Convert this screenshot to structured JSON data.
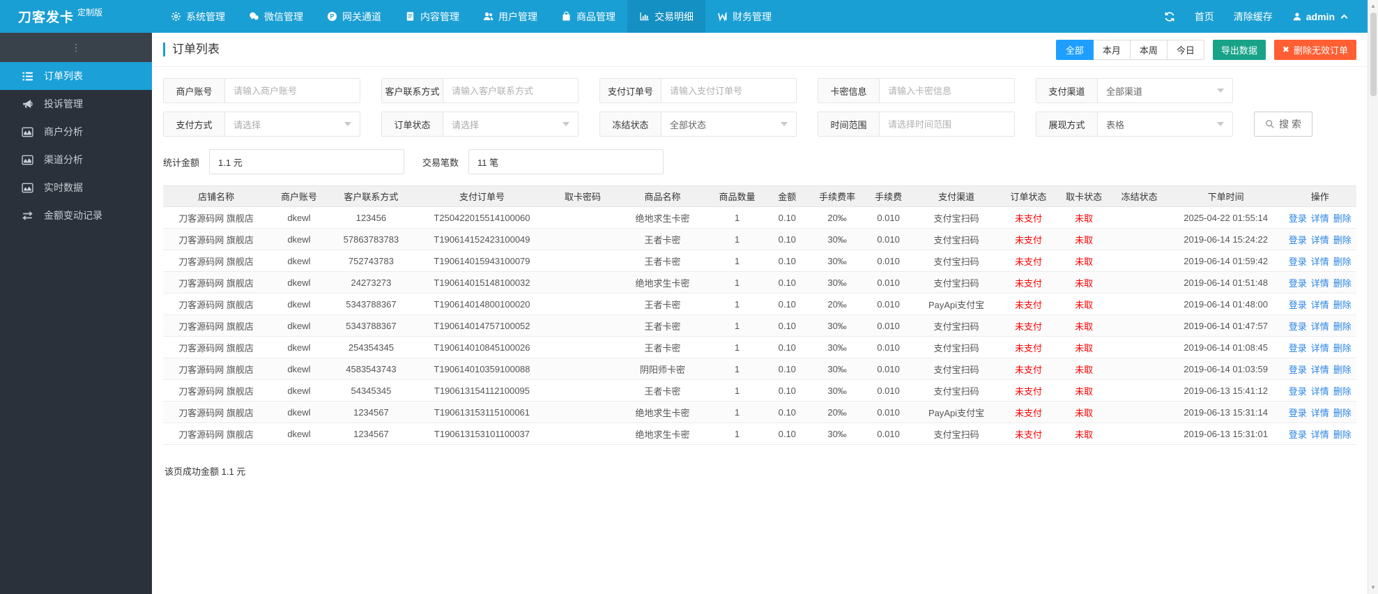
{
  "colors": {
    "topbar": "#1A9FD4",
    "topbar_active": "#1590C2",
    "sidebar": "#2B313A",
    "sidebar_strip": "#39414B",
    "sidebar_active": "#1BA0D8",
    "primary": "#1E9FFF",
    "export": "#18A389",
    "delete": "#FF5F33",
    "danger": "#FF0000",
    "link": "#2B85E4"
  },
  "topbar": {
    "brand": "刀客发卡",
    "brand_badge": "定制版",
    "nav": [
      {
        "id": "system",
        "label": "系统管理",
        "icon": "gear-icon",
        "active": false
      },
      {
        "id": "wechat",
        "label": "微信管理",
        "icon": "wechat-icon",
        "active": false
      },
      {
        "id": "gateway",
        "label": "网关通道",
        "icon": "gateway-icon",
        "active": false
      },
      {
        "id": "content",
        "label": "内容管理",
        "icon": "content-icon",
        "active": false
      },
      {
        "id": "users",
        "label": "用户管理",
        "icon": "users-icon",
        "active": false
      },
      {
        "id": "goods",
        "label": "商品管理",
        "icon": "goods-icon",
        "active": false
      },
      {
        "id": "transactions",
        "label": "交易明细",
        "icon": "transactions-icon",
        "active": true
      },
      {
        "id": "finance",
        "label": "财务管理",
        "icon": "finance-icon",
        "active": false
      }
    ],
    "actions": {
      "home": "首页",
      "clear_cache": "清除缓存",
      "user": "admin"
    }
  },
  "sidebar": {
    "collapse_hint": "⋮",
    "items": [
      {
        "id": "orders",
        "label": "订单列表",
        "icon": "order-list-icon",
        "active": true
      },
      {
        "id": "complaints",
        "label": "投诉管理",
        "icon": "complaint-icon",
        "active": false
      },
      {
        "id": "merchant-analysis",
        "label": "商户分析",
        "icon": "merchant-analysis-icon",
        "active": false
      },
      {
        "id": "channel-analysis",
        "label": "渠道分析",
        "icon": "channel-analysis-icon",
        "active": false
      },
      {
        "id": "realtime-data",
        "label": "实时数据",
        "icon": "realtime-icon",
        "active": false
      },
      {
        "id": "amount-change",
        "label": "金额变动记录",
        "icon": "amount-change-icon",
        "active": false
      }
    ]
  },
  "page": {
    "title": "订单列表",
    "range_tabs": [
      {
        "id": "all",
        "label": "全部",
        "active": true
      },
      {
        "id": "month",
        "label": "本月",
        "active": false
      },
      {
        "id": "week",
        "label": "本周",
        "active": false
      },
      {
        "id": "today",
        "label": "今日",
        "active": false
      }
    ],
    "export_btn": "导出数据",
    "delete_btn": "删除无效订单"
  },
  "filters": {
    "row1": [
      {
        "id": "merchant-account",
        "type": "text",
        "label": "商户账号",
        "placeholder": "请输入商户账号"
      },
      {
        "id": "customer-contact",
        "type": "text",
        "label": "客户联系方式",
        "placeholder": "请输入客户联系方式"
      },
      {
        "id": "pay-order-no",
        "type": "text",
        "label": "支付订单号",
        "placeholder": "请输入支付订单号"
      },
      {
        "id": "card-info",
        "type": "text",
        "label": "卡密信息",
        "placeholder": "请输入卡密信息"
      },
      {
        "id": "pay-channel",
        "type": "select",
        "label": "支付渠道",
        "value": "全部渠道",
        "muted": false
      }
    ],
    "row2": [
      {
        "id": "pay-method",
        "type": "select",
        "label": "支付方式",
        "value": "请选择",
        "muted": true
      },
      {
        "id": "order-status",
        "type": "select",
        "label": "订单状态",
        "value": "请选择",
        "muted": true
      },
      {
        "id": "freeze-status",
        "type": "select",
        "label": "冻结状态",
        "value": "全部状态",
        "muted": false
      },
      {
        "id": "time-range",
        "type": "text",
        "label": "时间范围",
        "placeholder": "请选择时间范围"
      },
      {
        "id": "display-mode",
        "type": "select",
        "label": "展现方式",
        "value": "表格",
        "muted": false
      }
    ],
    "search_btn": "搜 索"
  },
  "stats": [
    {
      "id": "total-amount",
      "label": "统计金额",
      "value": "1.1 元"
    },
    {
      "id": "trade-count",
      "label": "交易笔数",
      "value": "11 笔"
    }
  ],
  "table": {
    "columns": [
      {
        "key": "shop",
        "label": "店铺名称",
        "width": "8.9%"
      },
      {
        "key": "merchant",
        "label": "商户账号",
        "width": "5.0%"
      },
      {
        "key": "contact",
        "label": "客户联系方式",
        "width": "7.1%"
      },
      {
        "key": "order_no",
        "label": "支付订单号",
        "width": "11.5%"
      },
      {
        "key": "card_pwd",
        "label": "取卡密码",
        "width": "5.4%"
      },
      {
        "key": "product",
        "label": "商品名称",
        "width": "8.0%"
      },
      {
        "key": "qty",
        "label": "商品数量",
        "width": "4.5%"
      },
      {
        "key": "amount",
        "label": "金额",
        "width": "3.9%"
      },
      {
        "key": "fee_rate",
        "label": "手续费率",
        "width": "4.5%"
      },
      {
        "key": "fee",
        "label": "手续费",
        "width": "4.1%"
      },
      {
        "key": "channel",
        "label": "支付渠道",
        "width": "7.3%"
      },
      {
        "key": "order_status",
        "label": "订单状态",
        "width": "4.8%"
      },
      {
        "key": "card_status",
        "label": "取卡状态",
        "width": "4.5%"
      },
      {
        "key": "freeze_status",
        "label": "冻结状态",
        "width": "4.8%"
      },
      {
        "key": "time",
        "label": "下单时间",
        "width": "9.7%"
      },
      {
        "key": "actions",
        "label": "操作",
        "width": "6.1%"
      }
    ],
    "status_red_keys": [
      "order_status",
      "card_status"
    ],
    "action_labels": [
      "登录",
      "详情",
      "删除"
    ],
    "action_ids": [
      "login",
      "detail",
      "delete"
    ],
    "rows": [
      {
        "shop": "刀客源码网 旗舰店",
        "merchant": "dkewl",
        "contact": "123456",
        "order_no": "T250422015514100060",
        "card_pwd": "",
        "product": "绝地求生卡密",
        "qty": "1",
        "amount": "0.10",
        "fee_rate": "20‰",
        "fee": "0.010",
        "channel": "支付宝扫码",
        "order_status": "未支付",
        "card_status": "未取",
        "freeze_status": "",
        "time": "2025-04-22 01:55:14"
      },
      {
        "shop": "刀客源码网 旗舰店",
        "merchant": "dkewl",
        "contact": "57863783783",
        "order_no": "T190614152423100049",
        "card_pwd": "",
        "product": "王者卡密",
        "qty": "1",
        "amount": "0.10",
        "fee_rate": "30‰",
        "fee": "0.010",
        "channel": "支付宝扫码",
        "order_status": "未支付",
        "card_status": "未取",
        "freeze_status": "",
        "time": "2019-06-14 15:24:22"
      },
      {
        "shop": "刀客源码网 旗舰店",
        "merchant": "dkewl",
        "contact": "752743783",
        "order_no": "T190614015943100079",
        "card_pwd": "",
        "product": "王者卡密",
        "qty": "1",
        "amount": "0.10",
        "fee_rate": "30‰",
        "fee": "0.010",
        "channel": "支付宝扫码",
        "order_status": "未支付",
        "card_status": "未取",
        "freeze_status": "",
        "time": "2019-06-14 01:59:42"
      },
      {
        "shop": "刀客源码网 旗舰店",
        "merchant": "dkewl",
        "contact": "24273273",
        "order_no": "T190614015148100032",
        "card_pwd": "",
        "product": "绝地求生卡密",
        "qty": "1",
        "amount": "0.10",
        "fee_rate": "30‰",
        "fee": "0.010",
        "channel": "支付宝扫码",
        "order_status": "未支付",
        "card_status": "未取",
        "freeze_status": "",
        "time": "2019-06-14 01:51:48"
      },
      {
        "shop": "刀客源码网 旗舰店",
        "merchant": "dkewl",
        "contact": "5343788367",
        "order_no": "T190614014800100020",
        "card_pwd": "",
        "product": "王者卡密",
        "qty": "1",
        "amount": "0.10",
        "fee_rate": "20‰",
        "fee": "0.010",
        "channel": "PayApi支付宝",
        "order_status": "未支付",
        "card_status": "未取",
        "freeze_status": "",
        "time": "2019-06-14 01:48:00"
      },
      {
        "shop": "刀客源码网 旗舰店",
        "merchant": "dkewl",
        "contact": "5343788367",
        "order_no": "T190614014757100052",
        "card_pwd": "",
        "product": "王者卡密",
        "qty": "1",
        "amount": "0.10",
        "fee_rate": "30‰",
        "fee": "0.010",
        "channel": "支付宝扫码",
        "order_status": "未支付",
        "card_status": "未取",
        "freeze_status": "",
        "time": "2019-06-14 01:47:57"
      },
      {
        "shop": "刀客源码网 旗舰店",
        "merchant": "dkewl",
        "contact": "254354345",
        "order_no": "T190614010845100026",
        "card_pwd": "",
        "product": "王者卡密",
        "qty": "1",
        "amount": "0.10",
        "fee_rate": "30‰",
        "fee": "0.010",
        "channel": "支付宝扫码",
        "order_status": "未支付",
        "card_status": "未取",
        "freeze_status": "",
        "time": "2019-06-14 01:08:45"
      },
      {
        "shop": "刀客源码网 旗舰店",
        "merchant": "dkewl",
        "contact": "4583543743",
        "order_no": "T190614010359100088",
        "card_pwd": "",
        "product": "阴阳师卡密",
        "qty": "1",
        "amount": "0.10",
        "fee_rate": "30‰",
        "fee": "0.010",
        "channel": "支付宝扫码",
        "order_status": "未支付",
        "card_status": "未取",
        "freeze_status": "",
        "time": "2019-06-14 01:03:59"
      },
      {
        "shop": "刀客源码网 旗舰店",
        "merchant": "dkewl",
        "contact": "54345345",
        "order_no": "T190613154112100095",
        "card_pwd": "",
        "product": "王者卡密",
        "qty": "1",
        "amount": "0.10",
        "fee_rate": "30‰",
        "fee": "0.010",
        "channel": "支付宝扫码",
        "order_status": "未支付",
        "card_status": "未取",
        "freeze_status": "",
        "time": "2019-06-13 15:41:12"
      },
      {
        "shop": "刀客源码网 旗舰店",
        "merchant": "dkewl",
        "contact": "1234567",
        "order_no": "T190613153115100061",
        "card_pwd": "",
        "product": "绝地求生卡密",
        "qty": "1",
        "amount": "0.10",
        "fee_rate": "20‰",
        "fee": "0.010",
        "channel": "PayApi支付宝",
        "order_status": "未支付",
        "card_status": "未取",
        "freeze_status": "",
        "time": "2019-06-13 15:31:14"
      },
      {
        "shop": "刀客源码网 旗舰店",
        "merchant": "dkewl",
        "contact": "1234567",
        "order_no": "T190613153101100037",
        "card_pwd": "",
        "product": "绝地求生卡密",
        "qty": "1",
        "amount": "0.10",
        "fee_rate": "30‰",
        "fee": "0.010",
        "channel": "支付宝扫码",
        "order_status": "未支付",
        "card_status": "未取",
        "freeze_status": "",
        "time": "2019-06-13 15:31:01"
      }
    ]
  },
  "footer": {
    "note": "该页成功金额 1.1 元"
  }
}
